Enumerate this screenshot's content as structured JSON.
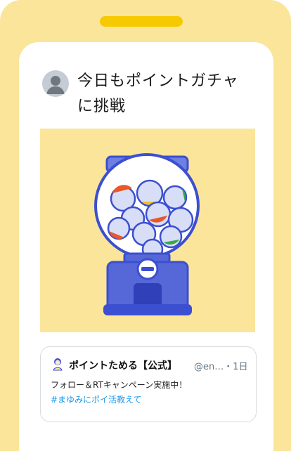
{
  "colors": {
    "frame": "#fbe59a",
    "notch": "#f7c900",
    "machine_blue": "#3b4fd0",
    "machine_light": "#d9def7",
    "link": "#1d9bf0"
  },
  "post": {
    "avatar_icon": "default-user-avatar",
    "title_line1": "今日もポイントガチャ",
    "title_line2": "に挑戦",
    "image_icon": "gachapon-machine"
  },
  "embed": {
    "avatar_icon": "character-avatar",
    "name": "ポイントためる【公式】",
    "handle": "@en…・1日",
    "text": "フォロー＆RTキャンペーン実施中！",
    "hashtag": "#まゆみにポイ活教えて"
  }
}
